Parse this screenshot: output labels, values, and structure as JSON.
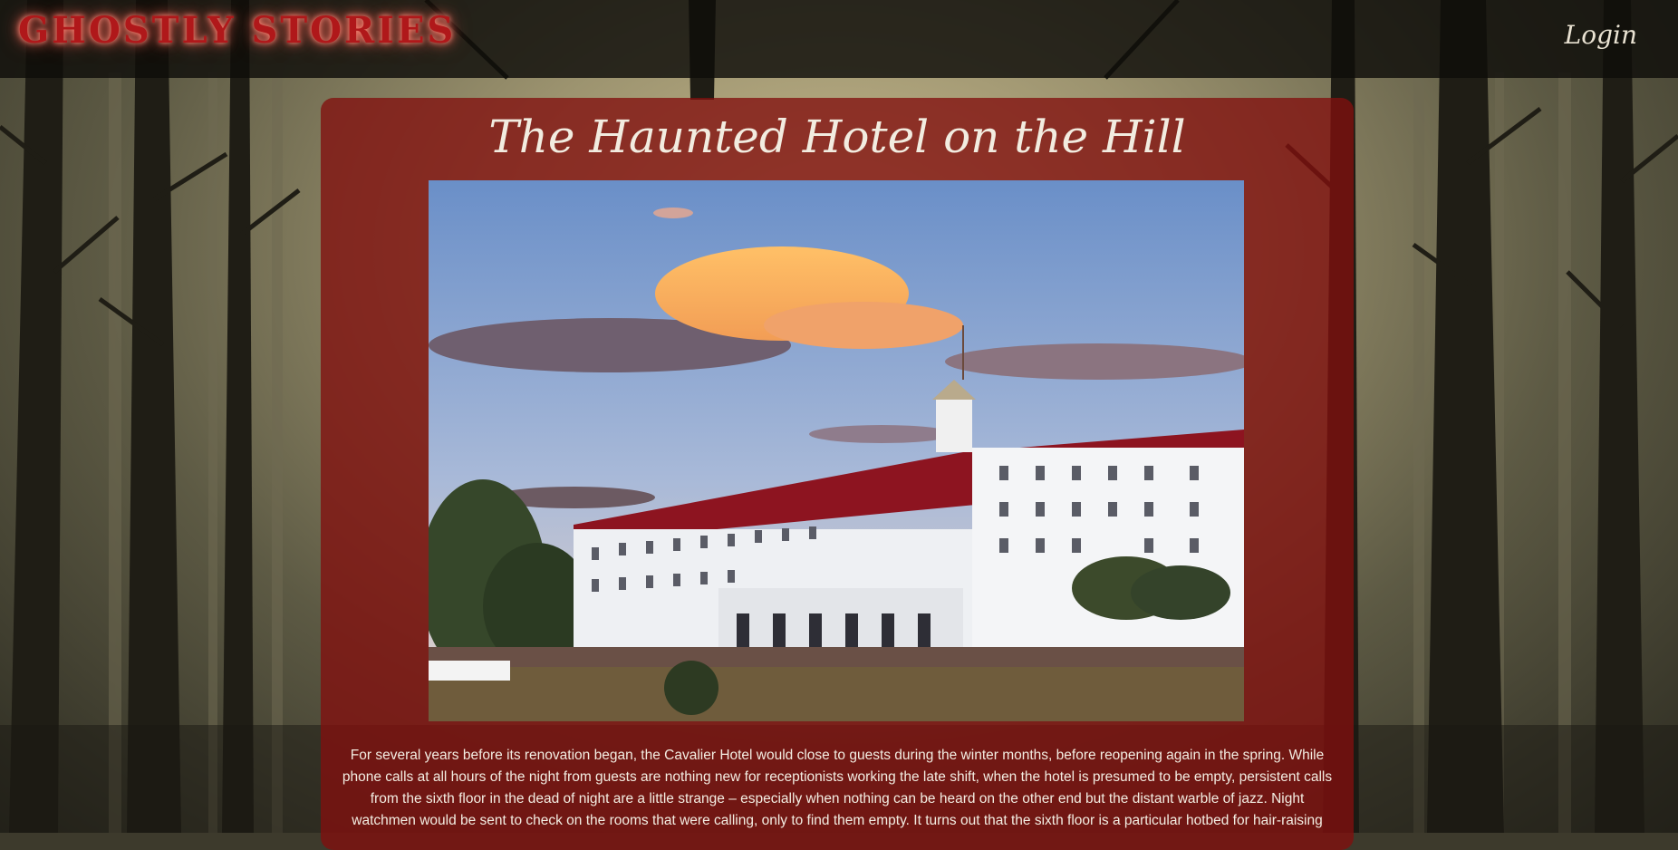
{
  "header": {
    "logo": "GHOSTLY STORIES",
    "login_label": "Login"
  },
  "article": {
    "title": "The Haunted Hotel on the Hill",
    "body": "For several years before its renovation began, the Cavalier Hotel would close to guests during the winter months, before reopening again in the spring. While phone calls at all hours of the night from guests are nothing new for receptionists working the late shift, when the hotel is presumed to be empty, persistent calls from the sixth floor in the dead of night are a little strange – especially when nothing can be heard on the other end but the distant warble of jazz. Night watchmen would be sent to check on the rooms that were calling, only to find them empty. It turns out that the sixth floor is a particular hotbed for hair-raising"
  },
  "colors": {
    "logo": "#b0181a",
    "panel": "#820f0e",
    "text": "#f3ede2"
  }
}
